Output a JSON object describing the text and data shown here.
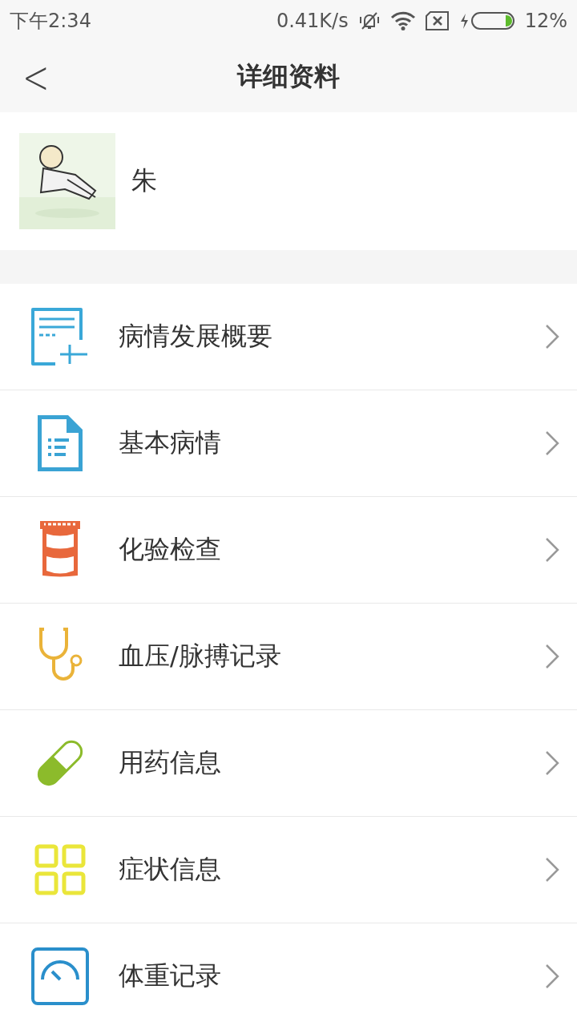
{
  "status_bar": {
    "time": "下午2:34",
    "net_speed": "0.41K/s",
    "battery": "12%"
  },
  "header": {
    "back": "<",
    "title": "详细资料"
  },
  "profile": {
    "name": "朱"
  },
  "menu": [
    {
      "label": "病情发展概要"
    },
    {
      "label": "基本病情"
    },
    {
      "label": "化验检查"
    },
    {
      "label": "血压/脉搏记录"
    },
    {
      "label": "用药信息"
    },
    {
      "label": "症状信息"
    },
    {
      "label": "体重记录"
    }
  ]
}
